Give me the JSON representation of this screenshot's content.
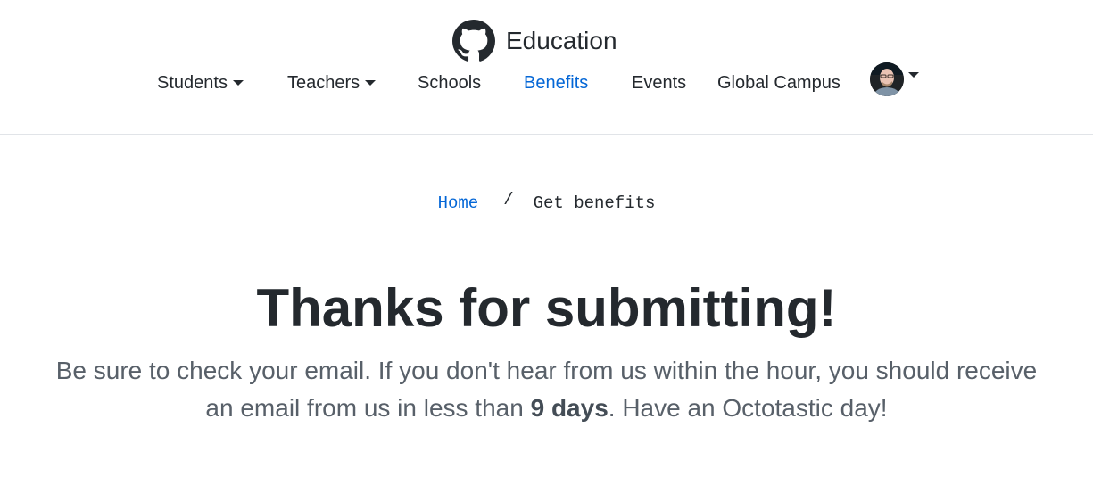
{
  "header": {
    "brand_label": "Education",
    "nav": [
      {
        "label": "Students",
        "has_dropdown": true
      },
      {
        "label": "Teachers",
        "has_dropdown": true
      },
      {
        "label": "Schools",
        "has_dropdown": false
      },
      {
        "label": "Benefits",
        "has_dropdown": false,
        "active": true
      },
      {
        "label": "Events",
        "has_dropdown": false
      },
      {
        "label": "Global Campus",
        "has_dropdown": false
      }
    ],
    "logo_icon": "github-octocat-icon",
    "user_menu_icon": "user-avatar"
  },
  "breadcrumb": {
    "home": "Home",
    "separator": "/",
    "current": "Get benefits"
  },
  "main": {
    "title": "Thanks for submitting!",
    "message_part1": "Be sure to check your email. If you don't hear from us within the hour, you should receive an email from us in less than ",
    "message_bold": "9 days",
    "message_part2": ". Have an Octotastic day!"
  },
  "colors": {
    "link": "#0366d6",
    "text": "#24292e",
    "muted": "#586069",
    "border": "#e1e4e8"
  }
}
